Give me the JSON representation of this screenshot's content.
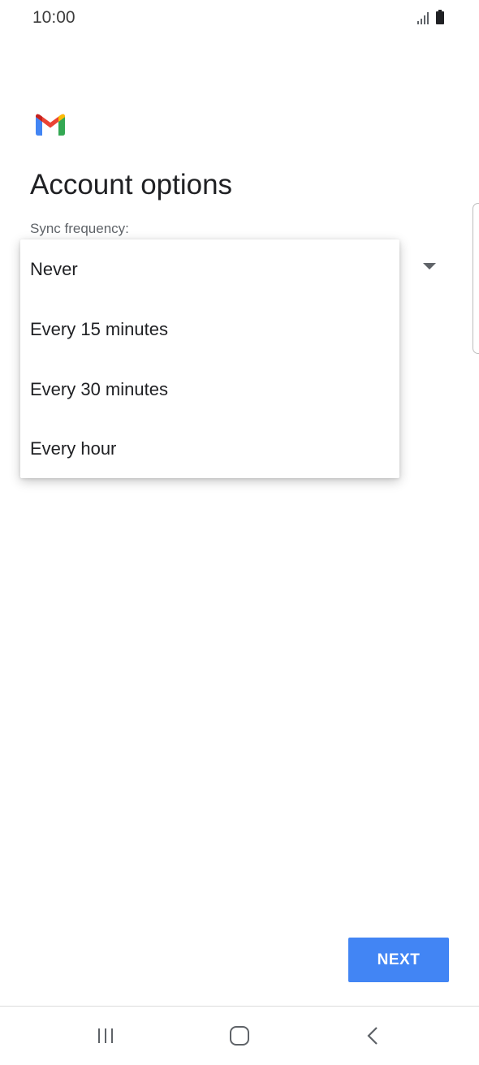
{
  "status_bar": {
    "time": "10:00",
    "icons": [
      "signal-icon",
      "battery-icon"
    ]
  },
  "header": {
    "logo": "gmail-logo-icon",
    "title": "Account options"
  },
  "form": {
    "sync_label": "Sync frequency:"
  },
  "dropdown": {
    "options": [
      "Never",
      "Every 15 minutes",
      "Every 30 minutes",
      "Every hour"
    ]
  },
  "footer": {
    "next_label": "NEXT"
  },
  "nav_bar": {
    "icons": [
      "recents-icon",
      "home-icon",
      "back-icon"
    ]
  },
  "colors": {
    "accent": "#4285f4",
    "gmail_red": "#ea4335",
    "gmail_blue": "#4285f4",
    "gmail_green": "#34a853",
    "gmail_yellow": "#fbbc04"
  }
}
